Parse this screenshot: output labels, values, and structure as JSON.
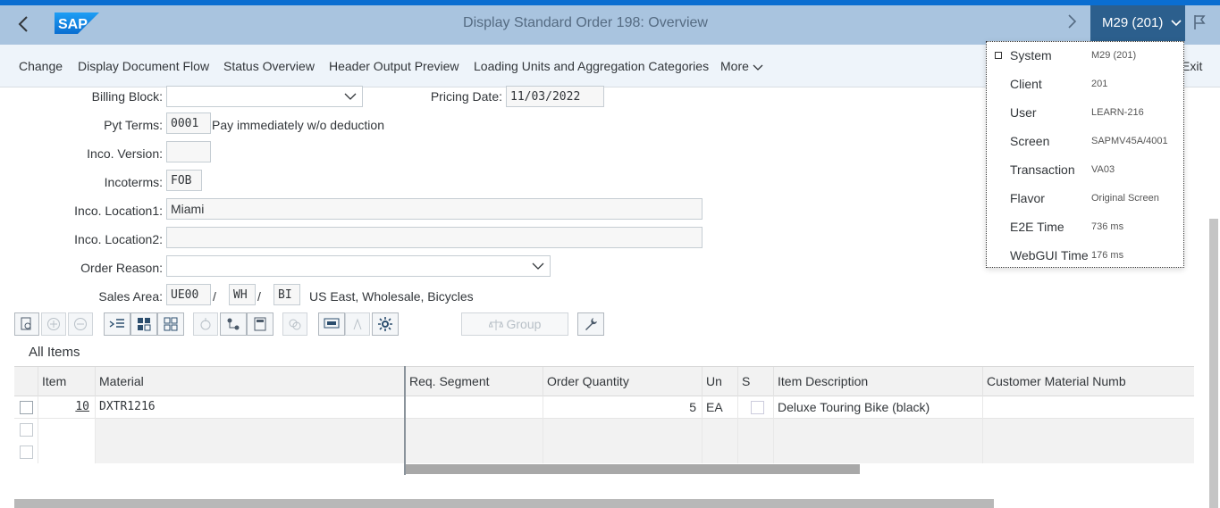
{
  "shell": {
    "title": "Display Standard Order 198: Overview",
    "system_button": "M29 (201)",
    "logo_text": "SAP",
    "back_glyph": "‹",
    "forward_glyph": "›",
    "chevron_glyph": "⌄"
  },
  "toolbar": {
    "items": [
      "Change",
      "Display Document Flow",
      "Status Overview",
      "Header Output Preview",
      "Loading Units and Aggregation Categories",
      "More"
    ],
    "exit_label": "Exit"
  },
  "form": {
    "billing_block": {
      "label": "Billing Block:",
      "value": ""
    },
    "pricing_date": {
      "label": "Pricing Date:",
      "value": "11/03/2022"
    },
    "pyt_terms": {
      "label": "Pyt Terms:",
      "value": "0001",
      "description": "Pay immediately w/o deduction"
    },
    "inco_version": {
      "label": "Inco. Version:",
      "value": ""
    },
    "incoterms": {
      "label": "Incoterms:",
      "value": "FOB"
    },
    "inco_location1": {
      "label": "Inco. Location1:",
      "value": "Miami"
    },
    "inco_location2": {
      "label": "Inco. Location2:",
      "value": ""
    },
    "order_reason": {
      "label": "Order Reason:",
      "value": ""
    },
    "sales_area": {
      "label": "Sales Area:",
      "sales_org": "UE00",
      "dist_channel": "WH",
      "division": "BI",
      "separator": "/",
      "description": "US East, Wholesale, Bicycles"
    }
  },
  "item_toolbar": {
    "group_label": "Group"
  },
  "section": {
    "title": "All Items"
  },
  "table": {
    "columns": [
      "Item",
      "Material",
      "Req. Segment",
      "Order Quantity",
      "Un",
      "S",
      "Item Description",
      "Customer Material Numb"
    ],
    "rows": [
      {
        "item": "10",
        "material": "DXTR1216",
        "req_segment": "",
        "order_quantity": "5",
        "unit": "EA",
        "description": "Deluxe Touring Bike (black)",
        "customer_material": ""
      }
    ]
  },
  "system_info": {
    "rows": [
      {
        "key": "System",
        "value": "M29 (201)"
      },
      {
        "key": "Client",
        "value": "201"
      },
      {
        "key": "User",
        "value": "LEARN-216"
      },
      {
        "key": "Screen",
        "value": "SAPMV45A/4001"
      },
      {
        "key": "Transaction",
        "value": "VA03"
      },
      {
        "key": "Flavor",
        "value": "Original Screen"
      },
      {
        "key": "E2E Time",
        "value": "736 ms"
      },
      {
        "key": "WebGUI Time",
        "value": "176 ms"
      }
    ]
  },
  "colors": {
    "shell_bg": "#a9c4df",
    "accent": "#0a6ed1",
    "system_button_bg": "#2c5f8d",
    "toolbar_bg": "#eef4fa"
  }
}
